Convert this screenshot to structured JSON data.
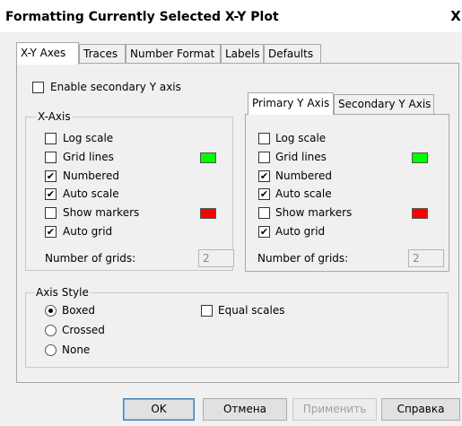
{
  "window": {
    "title": "Formatting Currently Selected X-Y Plot",
    "close_label": "X"
  },
  "tabs": [
    "X-Y Axes",
    "Traces",
    "Number Format",
    "Labels",
    "Defaults"
  ],
  "enable_secondary_y": {
    "label": "Enable secondary Y axis",
    "checked": false
  },
  "x_axis": {
    "title": "X-Axis",
    "options": [
      {
        "label": "Log scale",
        "checked": false
      },
      {
        "label": "Grid lines",
        "checked": false
      },
      {
        "label": "Numbered",
        "checked": true
      },
      {
        "label": "Auto scale",
        "checked": true
      },
      {
        "label": "Show markers",
        "checked": false
      },
      {
        "label": "Auto grid",
        "checked": true
      }
    ],
    "grid_color": "#00ff00",
    "marker_color": "#ff0000",
    "num_grids_label": "Number of grids:",
    "num_grids_value": "2"
  },
  "y_tabs": [
    "Primary Y Axis",
    "Secondary Y Axis"
  ],
  "y_axis": {
    "options": [
      {
        "label": "Log scale",
        "checked": false
      },
      {
        "label": "Grid lines",
        "checked": false
      },
      {
        "label": "Numbered",
        "checked": true
      },
      {
        "label": "Auto scale",
        "checked": true
      },
      {
        "label": "Show markers",
        "checked": false
      },
      {
        "label": "Auto grid",
        "checked": true
      }
    ],
    "grid_color": "#00ff00",
    "marker_color": "#ff0000",
    "num_grids_label": "Number of grids:",
    "num_grids_value": "2"
  },
  "axis_style": {
    "title": "Axis Style",
    "radios": [
      {
        "label": "Boxed",
        "selected": true
      },
      {
        "label": "Crossed",
        "selected": false
      },
      {
        "label": "None",
        "selected": false
      }
    ],
    "equal_scales": {
      "label": "Equal scales",
      "checked": false
    }
  },
  "buttons": {
    "ok": "OK",
    "cancel": "Отмена",
    "apply": "Применить",
    "help": "Справка"
  }
}
